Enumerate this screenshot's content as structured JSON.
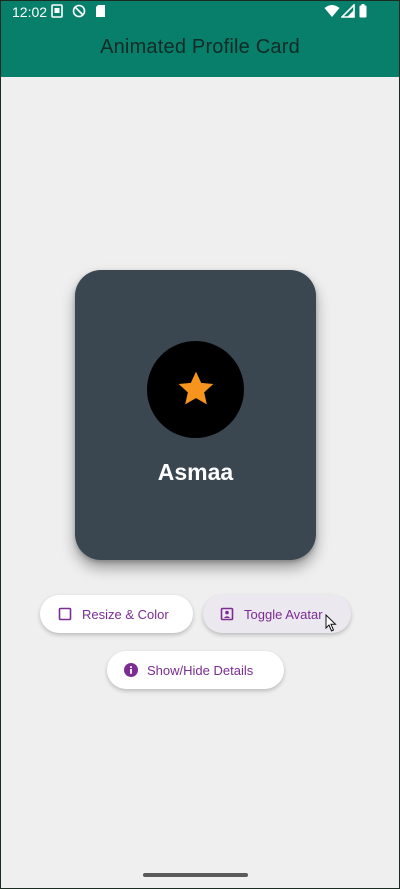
{
  "status_bar": {
    "time": "12:02",
    "icons": [
      "sim-card-icon",
      "vpn-shield-icon",
      "sd-card-icon",
      "wifi-icon",
      "signal-icon",
      "battery-icon"
    ]
  },
  "app_bar": {
    "title": "Animated Profile Card",
    "background": "#087f6b"
  },
  "profile_card": {
    "name": "Asmaa",
    "avatar_icon": "star-icon",
    "card_color": "#3a4650",
    "star_color": "#f7941d"
  },
  "actions": {
    "resize_color": {
      "label": "Resize & Color",
      "icon": "square-outline-icon"
    },
    "toggle_avatar": {
      "label": "Toggle Avatar",
      "icon": "portrait-icon"
    },
    "show_hide_details": {
      "label": "Show/Hide Details",
      "icon": "info-icon"
    }
  },
  "accent_color": "#7b2d91"
}
